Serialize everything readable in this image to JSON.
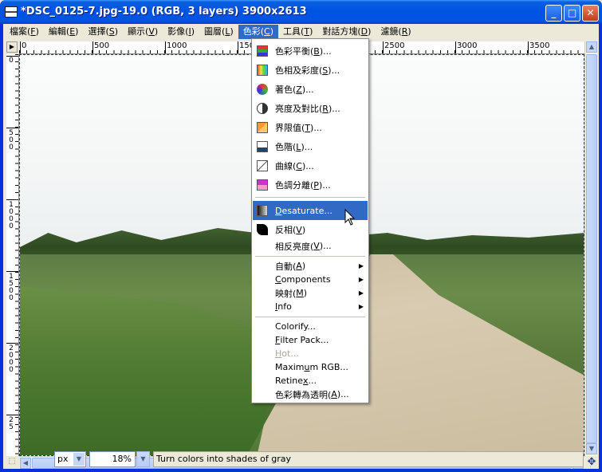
{
  "window": {
    "title": "*DSC_0125-7.jpg-19.0 (RGB, 3 layers) 3900x2613",
    "btn_min": "_",
    "btn_max": "□",
    "btn_close": "✕"
  },
  "menubar": {
    "items": [
      {
        "label": "檔案(",
        "key": "F",
        "end": ")"
      },
      {
        "label": "編輯(",
        "key": "E",
        "end": ")"
      },
      {
        "label": "選擇(",
        "key": "S",
        "end": ")"
      },
      {
        "label": "顯示(",
        "key": "V",
        "end": ")"
      },
      {
        "label": "影像(",
        "key": "I",
        "end": ")"
      },
      {
        "label": "圖層(",
        "key": "L",
        "end": ")"
      },
      {
        "label": "色彩(",
        "key": "C",
        "end": ")"
      },
      {
        "label": "工具(",
        "key": "T",
        "end": ")"
      },
      {
        "label": "對話方塊(",
        "key": "D",
        "end": ")"
      },
      {
        "label": "濾鏡(",
        "key": "R",
        "end": ")"
      }
    ]
  },
  "ruler": {
    "h_labels": [
      "0",
      "500",
      "1000",
      "150",
      "2500",
      "3000",
      "3500"
    ],
    "v_labels": [
      "0",
      "500",
      "1000",
      "1500",
      "2000",
      "25"
    ]
  },
  "popup": {
    "items": [
      {
        "label": "色彩平衡(",
        "key": "B",
        "end": ")..."
      },
      {
        "label": "色相及彩度(",
        "key": "S",
        "end": ")..."
      },
      {
        "label": "著色(",
        "key": "Z",
        "end": ")..."
      },
      {
        "label": "亮度及對比(",
        "key": "R",
        "end": ")..."
      },
      {
        "label": "界限值(",
        "key": "T",
        "end": ")..."
      },
      {
        "label": "色階(",
        "key": "L",
        "end": ")..."
      },
      {
        "label": "曲線(",
        "key": "C",
        "end": ")..."
      },
      {
        "label": "色調分離(",
        "key": "P",
        "end": ")..."
      },
      {
        "label": "",
        "key": "D",
        "end": "esaturate..."
      },
      {
        "label": "反相(",
        "key": "V",
        "end": ")"
      },
      {
        "label": "相反亮度(",
        "key": "V",
        "end": ")..."
      },
      {
        "label": "自動(",
        "key": "A",
        "end": ")"
      },
      {
        "label": "",
        "key": "C",
        "end": "omponents"
      },
      {
        "label": "映射(",
        "key": "M",
        "end": ")"
      },
      {
        "label": "",
        "key": "I",
        "end": "nfo"
      },
      {
        "label": "Colorify...",
        "key": "",
        "end": ""
      },
      {
        "label": "",
        "key": "F",
        "end": "ilter Pack..."
      },
      {
        "label": "",
        "key": "H",
        "end": "ot..."
      },
      {
        "label": "Maxim",
        "key": "u",
        "end": "m RGB..."
      },
      {
        "label": "Retine",
        "key": "x",
        "end": "..."
      },
      {
        "label": "色彩轉為透明(",
        "key": "A",
        "end": ")..."
      }
    ]
  },
  "status": {
    "unit": "px",
    "zoom": "18%",
    "message": "Turn colors into shades of gray"
  },
  "colors": {
    "titlebar": "#0054e3",
    "highlight": "#316ac5"
  }
}
